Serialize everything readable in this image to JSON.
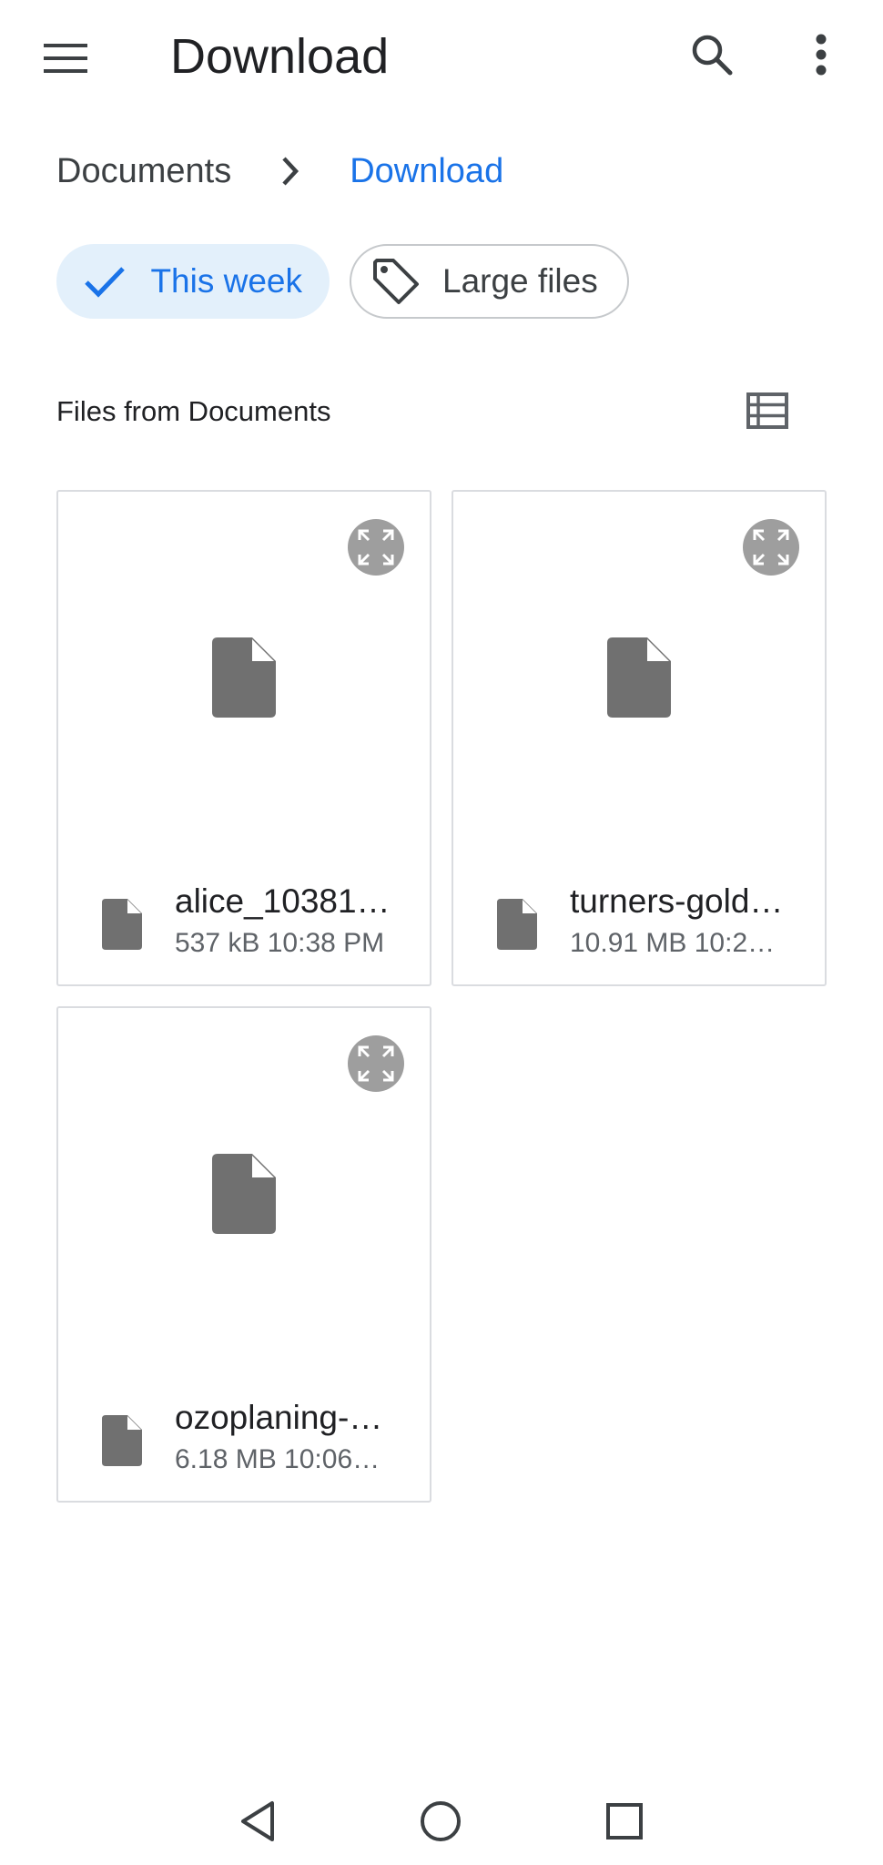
{
  "appbar": {
    "title": "Download",
    "menu_icon": "menu-icon",
    "search_icon": "search-icon",
    "more_icon": "more-vert-icon"
  },
  "breadcrumb": {
    "items": [
      "Documents",
      "Download"
    ],
    "separator_icon": "chevron-right-icon"
  },
  "filters": {
    "chips": [
      {
        "label": "This week",
        "icon": "check-icon",
        "selected": true
      },
      {
        "label": "Large files",
        "icon": "tag-icon",
        "selected": false
      }
    ]
  },
  "section": {
    "title": "Files from Documents",
    "view_toggle_icon": "list-view-icon"
  },
  "files": [
    {
      "name": "alice_10381…",
      "meta": "537 kB 10:38 PM",
      "icon": "file-icon"
    },
    {
      "name": "turners-gold…",
      "meta": "10.91 MB 10:2…",
      "icon": "file-icon"
    },
    {
      "name": "ozoplaning-…",
      "meta": "6.18 MB 10:06…",
      "icon": "file-icon"
    }
  ],
  "navbar": {
    "back_icon": "back-triangle-icon",
    "home_icon": "home-circle-icon",
    "recents_icon": "recents-square-icon"
  },
  "colors": {
    "accent": "#1a73e8",
    "chip_selected_bg": "#e3f0fb",
    "file_icon": "#707070",
    "expand_bg": "#9e9e9e",
    "border": "#dadce0"
  }
}
